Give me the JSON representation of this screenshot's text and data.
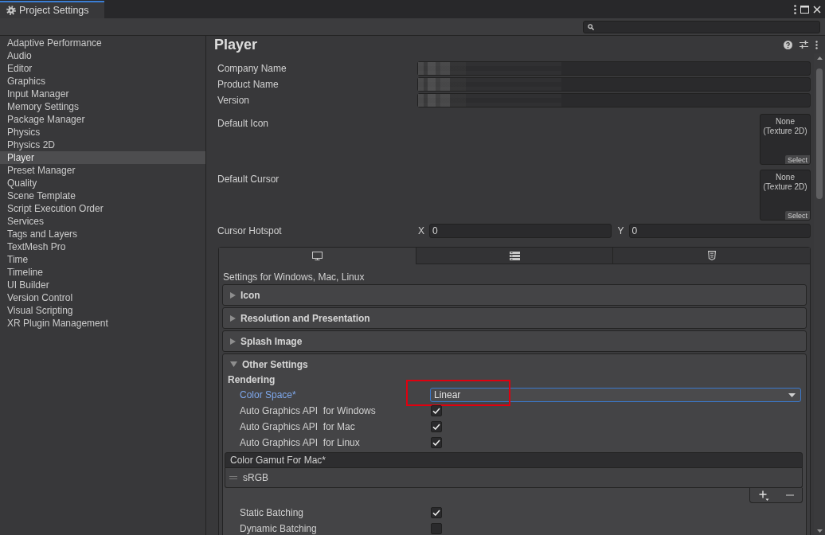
{
  "window": {
    "tab_title": "Project Settings"
  },
  "sidebar": {
    "items": [
      {
        "label": "Adaptive Performance",
        "selected": false
      },
      {
        "label": "Audio",
        "selected": false
      },
      {
        "label": "Editor",
        "selected": false
      },
      {
        "label": "Graphics",
        "selected": false
      },
      {
        "label": "Input Manager",
        "selected": false
      },
      {
        "label": "Memory Settings",
        "selected": false
      },
      {
        "label": "Package Manager",
        "selected": false
      },
      {
        "label": "Physics",
        "selected": false
      },
      {
        "label": "Physics 2D",
        "selected": false
      },
      {
        "label": "Player",
        "selected": true
      },
      {
        "label": "Preset Manager",
        "selected": false
      },
      {
        "label": "Quality",
        "selected": false
      },
      {
        "label": "Scene Template",
        "selected": false
      },
      {
        "label": "Script Execution Order",
        "selected": false
      },
      {
        "label": "Services",
        "selected": false
      },
      {
        "label": "Tags and Layers",
        "selected": false
      },
      {
        "label": "TextMesh Pro",
        "selected": false
      },
      {
        "label": "Time",
        "selected": false
      },
      {
        "label": "Timeline",
        "selected": false
      },
      {
        "label": "UI Builder",
        "selected": false
      },
      {
        "label": "Version Control",
        "selected": false
      },
      {
        "label": "Visual Scripting",
        "selected": false
      },
      {
        "label": "XR Plugin Management",
        "selected": false
      }
    ]
  },
  "inspector": {
    "title": "Player",
    "fields": [
      {
        "kind": "text",
        "label": "Company Name",
        "redacted": true
      },
      {
        "kind": "text",
        "label": "Product Name",
        "redacted": true
      },
      {
        "kind": "text",
        "label": "Version",
        "redacted": true
      },
      {
        "kind": "texture",
        "label": "Default Icon",
        "value": "None (Texture 2D)",
        "button": "Select"
      },
      {
        "kind": "texture",
        "label": "Default Cursor",
        "value": "None (Texture 2D)",
        "button": "Select"
      },
      {
        "kind": "vector2",
        "label": "Cursor Hotspot",
        "components": [
          {
            "axis": "X",
            "value": "0"
          },
          {
            "axis": "Y",
            "value": "0"
          }
        ]
      }
    ],
    "platform_tabs": [
      {
        "kind": "desktop",
        "selected": true
      },
      {
        "kind": "server",
        "selected": false
      },
      {
        "kind": "web",
        "selected": false
      }
    ],
    "platform_heading": "Settings for Windows, Mac, Linux",
    "sections": [
      {
        "title": "Icon",
        "expanded": false
      },
      {
        "title": "Resolution and Presentation",
        "expanded": false
      },
      {
        "title": "Splash Image",
        "expanded": false
      },
      {
        "title": "Other Settings",
        "expanded": true,
        "subheading": "Rendering",
        "rows": [
          {
            "kind": "dropdown",
            "label": "Color Space*",
            "value": "Linear",
            "focused": true,
            "highlighted": true
          },
          {
            "kind": "checkbox",
            "label": "Auto Graphics API  for Windows",
            "checked": true
          },
          {
            "kind": "checkbox",
            "label": "Auto Graphics API  for Mac",
            "checked": true
          },
          {
            "kind": "checkbox",
            "label": "Auto Graphics API  for Linux",
            "checked": true
          },
          {
            "kind": "list",
            "title": "Color Gamut For Mac*",
            "items": [
              "sRGB"
            ]
          },
          {
            "kind": "checkbox",
            "label": "Static Batching",
            "checked": true
          },
          {
            "kind": "checkbox",
            "label": "Dynamic Batching",
            "checked": false
          }
        ]
      }
    ]
  }
}
